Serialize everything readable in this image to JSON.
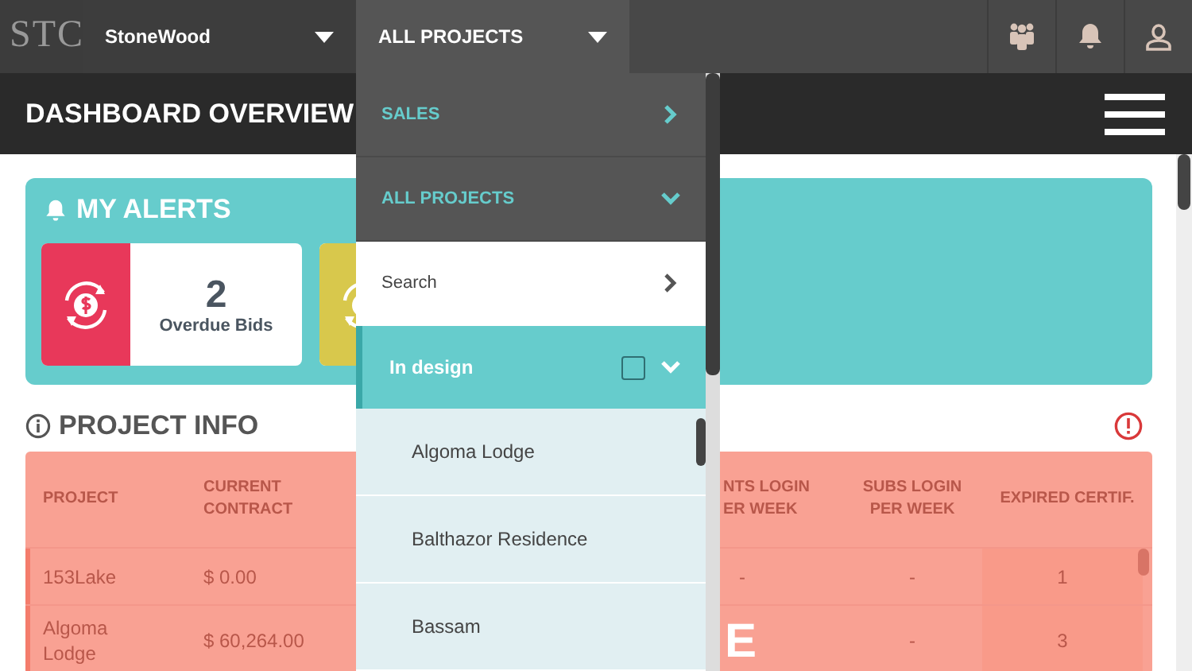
{
  "top_bar": {
    "logo": "STC",
    "company": {
      "label": "StoneWood"
    },
    "project_filter": {
      "label": "ALL PROJECTS"
    }
  },
  "header": {
    "title": "DASHBOARD OVERVIEW"
  },
  "alerts": {
    "title": "MY ALERTS",
    "cards": [
      {
        "kind": "full",
        "count": "2",
        "label": "Overdue Bids",
        "color": "#e8385a"
      },
      {
        "kind": "partial",
        "color": "#d8c84c"
      }
    ]
  },
  "project_info": {
    "title": "PROJECT INFO",
    "columns": [
      "PROJECT",
      "CURRENT CONTRACT",
      "NTS LOGIN ER WEEK",
      "SUBS LOGIN PER WEEK",
      "EXPIRED CERTIF."
    ],
    "rows": [
      {
        "project": "153Lake",
        "current_contract": "$ 0.00",
        "nts_login": "-",
        "subs_login": "-",
        "expired_certif": "1"
      },
      {
        "project": "Algoma Lodge",
        "current_contract": "$ 60,264.00",
        "subs_login": "-",
        "expired_certif": "3"
      }
    ],
    "overlay_text": "E"
  },
  "project_menu": {
    "items": [
      {
        "kind": "section",
        "label": "SALES",
        "expanded": false
      },
      {
        "kind": "section",
        "label": "ALL PROJECTS",
        "expanded": true
      },
      {
        "kind": "search",
        "label": "Search"
      },
      {
        "kind": "group",
        "label": "In design",
        "expanded": true,
        "checked": false
      },
      {
        "kind": "project",
        "label": "Algoma Lodge"
      },
      {
        "kind": "project",
        "label": "Balthazor Residence"
      },
      {
        "kind": "project",
        "label": "Bassam"
      }
    ]
  }
}
